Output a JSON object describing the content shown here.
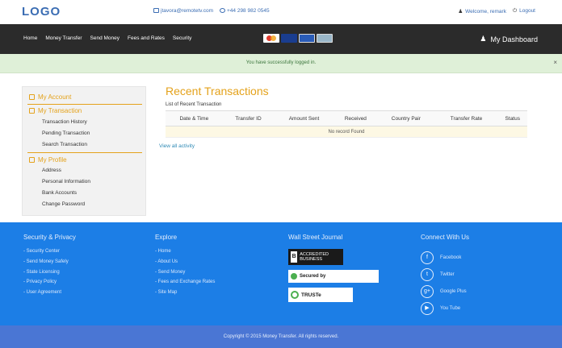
{
  "header": {
    "logo": "LOGO",
    "email": "jtavora@remotetv.com",
    "phone": "+44 298 982 0545",
    "welcome": "Welcome, remark",
    "logout": "Logout"
  },
  "nav": {
    "items": [
      "Home",
      "Money Transfer",
      "Send Money",
      "Fees and Rates",
      "Security"
    ],
    "dashboard": "My Dashboard",
    "cards": [
      "mastercard",
      "visa",
      "visa",
      "amex"
    ]
  },
  "alert": {
    "message": "You have successfully logged in.",
    "close": "×"
  },
  "sidebar": {
    "account": "My Account",
    "transaction": "My Transaction",
    "transaction_items": [
      "Transaction History",
      "Pending Transaction",
      "Search Transaction"
    ],
    "profile": "My Profile",
    "profile_items": [
      "Address",
      "Personal Information",
      "Bank Accounts",
      "Change Password"
    ]
  },
  "main": {
    "title": "Recent Transactions",
    "caption": "List of Recent Transaction",
    "columns": [
      "Date & Time",
      "Transfer ID",
      "Amount Sent",
      "Received",
      "Country Pair",
      "Transfer Rate",
      "Status"
    ],
    "empty": "No record Found",
    "view_all": "View all activity"
  },
  "footer": {
    "security": {
      "title": "Security & Privacy",
      "links": [
        "Security Center",
        "Send Money Safely",
        "State Licensing",
        "Privacy Policy",
        "User Agreement"
      ]
    },
    "explore": {
      "title": "Explore",
      "links": [
        "Home",
        "About Us",
        "Send Money",
        "Fees and Exchange Rates",
        "Site Map"
      ]
    },
    "wsj": {
      "title": "Wall Street Journal",
      "bbb": "ACCREDITED BUSINESS",
      "secured": "Secured by",
      "truste": "TRUSTe"
    },
    "connect": {
      "title": "Connect With Us",
      "items": [
        "Facebook",
        "Twitter",
        "Google Plus",
        "You Tube"
      ]
    },
    "copyright": "Copyright © 2015 Money Transfer. All rights reserved."
  }
}
